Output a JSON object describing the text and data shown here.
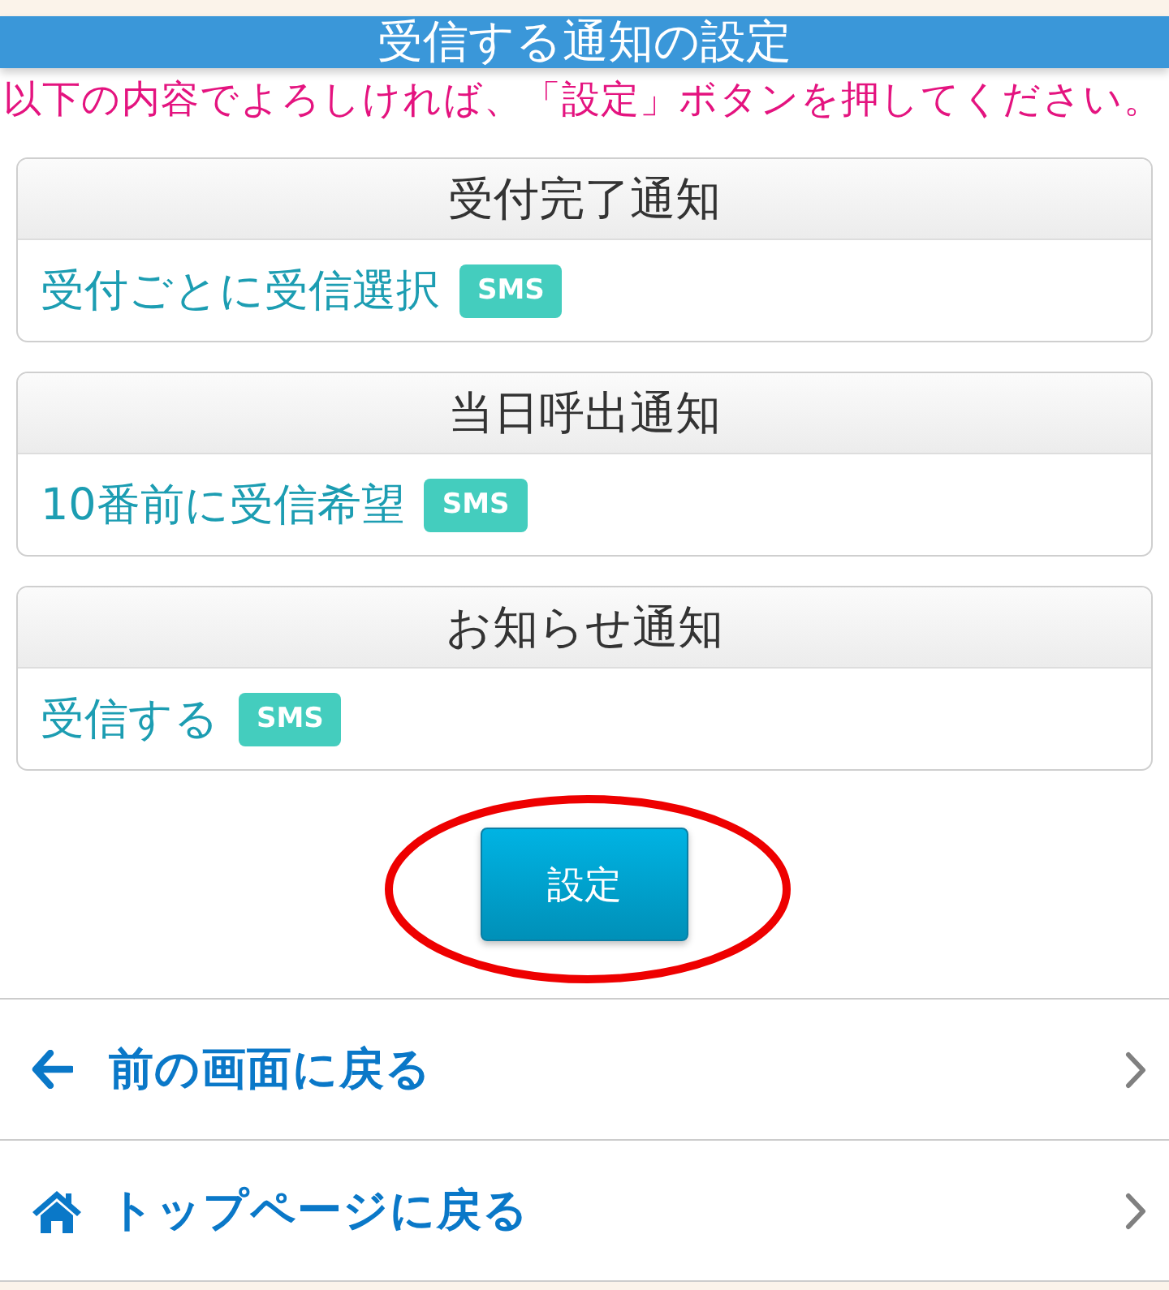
{
  "header": {
    "title": "受信する通知の設定"
  },
  "instruction": "以下の内容でよろしければ、「設定」ボタンを押してください。",
  "notifications": [
    {
      "title": "受付完了通知",
      "value": "受付ごとに受信選択",
      "badge": "SMS"
    },
    {
      "title": "当日呼出通知",
      "value": "10番前に受信希望",
      "badge": "SMS"
    },
    {
      "title": "お知らせ通知",
      "value": "受信する",
      "badge": "SMS"
    }
  ],
  "submit_button": {
    "label": "設定",
    "highlighted": true
  },
  "nav_links": [
    {
      "kind": "back",
      "label": "前の画面に戻る"
    },
    {
      "kind": "home",
      "label": "トップページに戻る"
    }
  ]
}
